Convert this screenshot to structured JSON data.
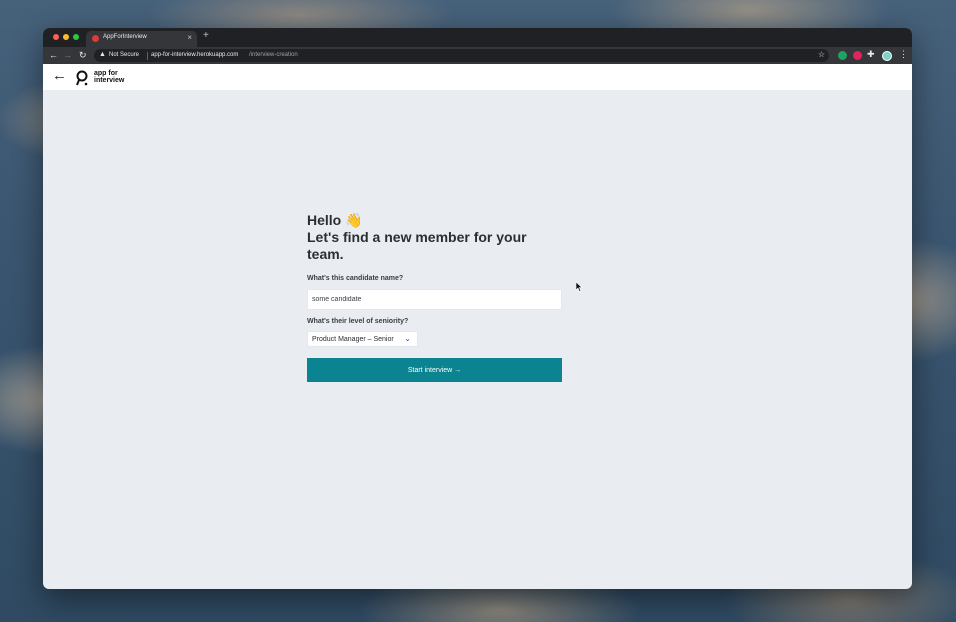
{
  "browser": {
    "tab_title": "AppForInterview",
    "tab_close": "×",
    "new_tab": "+",
    "not_secure": "Not Secure",
    "url_host": "app-for-interview.herokuapp.com",
    "url_path": "/interview-creation"
  },
  "header": {
    "logo_line1": "app for",
    "logo_line2": "interview"
  },
  "main": {
    "hello": "Hello 👋",
    "subtitle": "Let's find a new member for your team.",
    "name_label": "What's this candidate name?",
    "name_value": "some candidate",
    "seniority_label": "What's their level of seniority?",
    "seniority_value": "Product Manager – Senior",
    "start_button": "Start interview →"
  },
  "colors": {
    "accent": "#0b8390",
    "page_bg": "#e9ecf0"
  }
}
